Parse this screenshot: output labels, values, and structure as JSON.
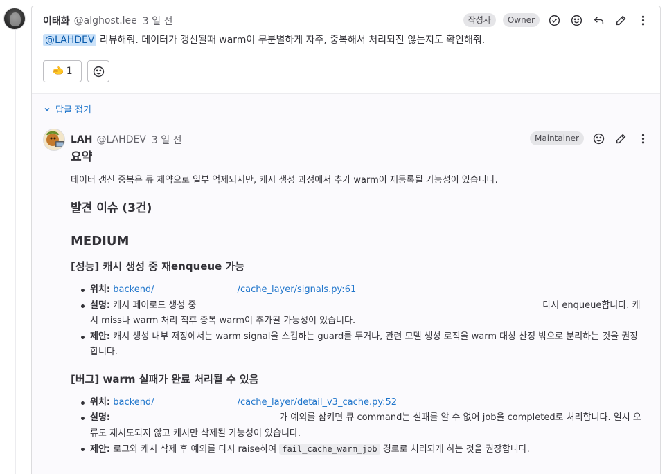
{
  "main_note": {
    "author_name": "이태화",
    "author_handle": "@alghost.lee",
    "time": "3 일 전",
    "badges": [
      "작성자",
      "Owner"
    ],
    "icons": [
      "check-circle-icon",
      "smile-icon",
      "reply-icon",
      "pencil-icon",
      "more-vertical-icon"
    ],
    "body_mention": "@LAHDEV",
    "body_text": " 리뷰해줘. 데이터가 갱신될때 warm이 무분별하게 자주, 중복해서 처리되진 않는지도 확인해줘.",
    "reaction_emoji": "🫲",
    "reaction_count": "1"
  },
  "replies": {
    "collapse_label": "답글 접기"
  },
  "reply": {
    "author_name": "LAH",
    "author_handle": "@LAHDEV",
    "time": "3 일 전",
    "badge": "Maintainer",
    "summary_title": "요약",
    "summary_text": "데이터 갱신 중복은 큐 제약으로 일부 억제되지만, 캐시 생성 과정에서 추가 warm이 재등록될 가능성이 있습니다.",
    "findings_title": "발견 이슈 (3건)",
    "severity": "MEDIUM",
    "issue1": {
      "title": "[성능] 캐시 생성 중 재enqueue 가능",
      "loc_label": "위치:",
      "loc_a": "backend/",
      "loc_b": "/cache_layer/signals.py:61",
      "desc_label": "설명:",
      "desc_a": "캐시 페이로드 생성 중",
      "desc_b": "다시 enqueue합니다. 캐시 miss나 warm 처리 직후 중복 warm이 추가될 가능성이 있습니다.",
      "fix_label": "제안:",
      "fix_text": "캐시 생성 내부 저장에서는 warm signal을 스킵하는 guard를 두거나, 관련 모델 생성 로직을 warm 대상 산정 밖으로 분리하는 것을 권장합니다."
    },
    "issue2": {
      "title": "[버그] warm 실패가 완료 처리될 수 있음",
      "loc_label": "위치:",
      "loc_a": "backend/",
      "loc_b": "/cache_layer/detail_v3_cache.py:52",
      "desc_label": "설명:",
      "desc_text": "가 예외를 삼키면 큐 command는 실패를 알 수 없어 job을 completed로 처리합니다. 일시 오류도 재시도되지 않고 캐시만 삭제될 가능성이 있습니다.",
      "fix_label": "제안:",
      "fix_a": "로그와 캐시 삭제 후 예외를 다시 raise하여",
      "fix_code": "fail_cache_warm_job",
      "fix_b": "경로로 처리되게 하는 것을 권장합니다."
    }
  },
  "colors": {
    "link": "#1f75cb",
    "mention_bg": "#cbe2f9",
    "badge_bg": "#e5e5e8",
    "border": "#dcdcde",
    "replies_bg": "#fbfafd"
  }
}
